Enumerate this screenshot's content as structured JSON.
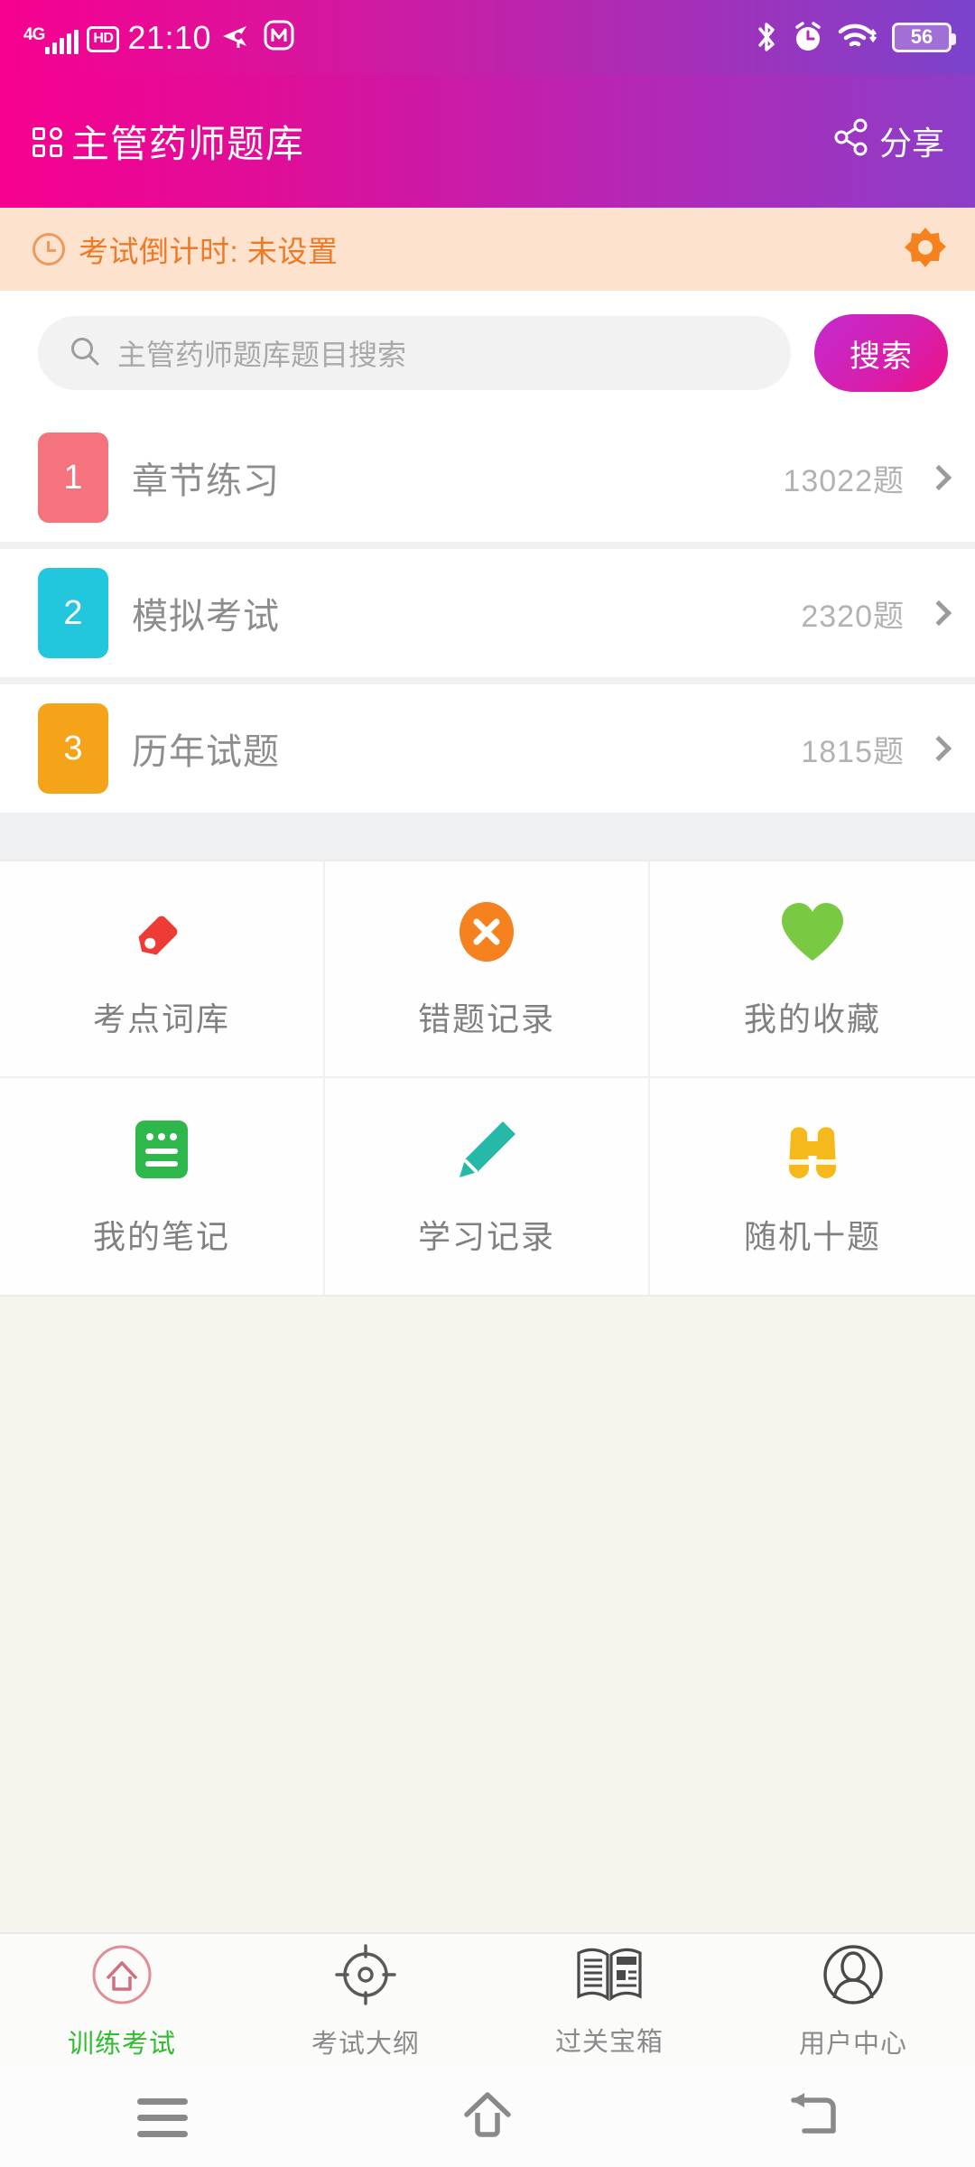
{
  "status_bar": {
    "network_label": "4G",
    "hd_label": "HD",
    "time": "21:10",
    "battery_percent": "56",
    "icons": [
      "signal-bars-icon",
      "hd-icon",
      "location-icon",
      "app-m-icon",
      "bluetooth-icon",
      "alarm-clock-icon",
      "wifi-icon",
      "battery-icon"
    ]
  },
  "header": {
    "title": "主管药师题库",
    "share_label": "分享",
    "gradient_start": "#f7008f",
    "gradient_end": "#8b3ec8"
  },
  "countdown": {
    "text": "考试倒计时: 未设置",
    "accent_color": "#ee7a28",
    "background_color": "#fde3cd"
  },
  "search": {
    "placeholder": "主管药师题库题目搜索",
    "button_label": "搜索"
  },
  "practice_list": [
    {
      "number": "1",
      "label": "章节练习",
      "count": "13022题",
      "color": "#f4737d"
    },
    {
      "number": "2",
      "label": "模拟考试",
      "count": "2320题",
      "color": "#22c6dd"
    },
    {
      "number": "3",
      "label": "历年试题",
      "count": "1815题",
      "color": "#f5a318"
    }
  ],
  "tiles": [
    {
      "label": "考点词库",
      "icon": "tag-icon",
      "color": "#ef3b35"
    },
    {
      "label": "错题记录",
      "icon": "close-circle-icon",
      "color": "#f5821f"
    },
    {
      "label": "我的收藏",
      "icon": "heart-icon",
      "color": "#7ac943"
    },
    {
      "label": "我的笔记",
      "icon": "note-icon",
      "color": "#2eb84b"
    },
    {
      "label": "学习记录",
      "icon": "pencil-icon",
      "color": "#26b9a8"
    },
    {
      "label": "随机十题",
      "icon": "binoculars-icon",
      "color": "#f6b91b"
    }
  ],
  "tab_bar": [
    {
      "label": "训练考试",
      "icon": "home-circle-icon",
      "active": true,
      "color": "#2fbe2f"
    },
    {
      "label": "考试大纲",
      "icon": "target-icon",
      "active": false,
      "color": "#8a8a8a"
    },
    {
      "label": "过关宝箱",
      "icon": "newspaper-icon",
      "active": false,
      "color": "#8a8a8a"
    },
    {
      "label": "用户中心",
      "icon": "user-icon",
      "active": false,
      "color": "#8a8a8a"
    }
  ],
  "system_nav": [
    {
      "icon": "menu-icon"
    },
    {
      "icon": "home-icon"
    },
    {
      "icon": "back-icon"
    }
  ]
}
